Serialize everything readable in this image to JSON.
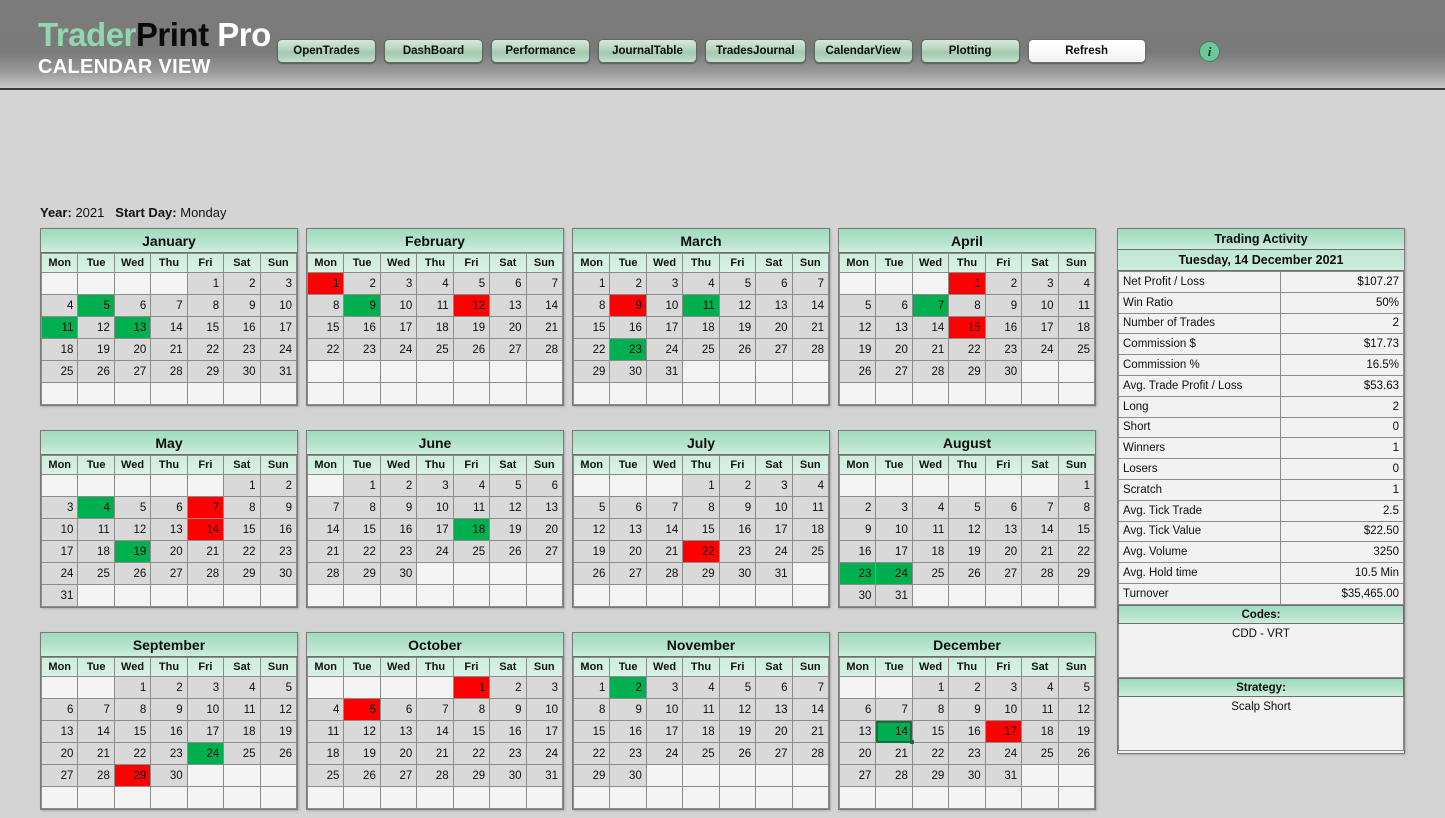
{
  "brand": {
    "part1": "Trader",
    "part2": "Print",
    "part3": " Pro",
    "subtitle": "CALENDAR VIEW"
  },
  "nav": {
    "buttons": [
      {
        "label": "OpenTrades"
      },
      {
        "label": "DashBoard"
      },
      {
        "label": "Performance"
      },
      {
        "label": "JournalTable"
      },
      {
        "label": "TradesJournal"
      },
      {
        "label": "CalendarView"
      },
      {
        "label": "Plotting"
      }
    ],
    "refresh_label": "Refresh",
    "info_label": "i"
  },
  "meta": {
    "year_label": "Year:",
    "year_value": "2021",
    "start_day_label": "Start Day:",
    "start_day_value": "Monday"
  },
  "weekdays": [
    "Mon",
    "Tue",
    "Wed",
    "Thu",
    "Fri",
    "Sat",
    "Sun"
  ],
  "colors": {
    "win": "#00b050",
    "loss": "#ff0000",
    "header_green": "#9fdcbd",
    "brand_green": "#8fd8b0",
    "cell_gray": "#d9d9d9",
    "page_bg": "#d4d4d4",
    "topbar_gray": "#7c7c7c"
  },
  "months": [
    {
      "name": "January",
      "start": 5,
      "days": 31,
      "win": [
        5,
        11,
        13
      ],
      "loss": [],
      "selected": null
    },
    {
      "name": "February",
      "start": 1,
      "days": 28,
      "win": [
        9
      ],
      "loss": [
        1,
        12
      ],
      "selected": null
    },
    {
      "name": "March",
      "start": 1,
      "days": 31,
      "win": [
        11,
        23
      ],
      "loss": [
        9
      ],
      "selected": null
    },
    {
      "name": "April",
      "start": 4,
      "days": 30,
      "win": [
        7
      ],
      "loss": [
        1,
        15
      ],
      "selected": null
    },
    {
      "name": "May",
      "start": 6,
      "days": 31,
      "win": [
        4,
        19
      ],
      "loss": [
        7,
        14
      ],
      "selected": null
    },
    {
      "name": "June",
      "start": 2,
      "days": 30,
      "win": [
        18
      ],
      "loss": [],
      "selected": null
    },
    {
      "name": "July",
      "start": 4,
      "days": 31,
      "win": [],
      "loss": [
        22
      ],
      "selected": null
    },
    {
      "name": "August",
      "start": 7,
      "days": 31,
      "win": [
        23,
        24
      ],
      "loss": [],
      "selected": null
    },
    {
      "name": "September",
      "start": 3,
      "days": 30,
      "win": [
        24
      ],
      "loss": [
        29
      ],
      "selected": null
    },
    {
      "name": "October",
      "start": 5,
      "days": 31,
      "win": [],
      "loss": [
        1,
        5
      ],
      "selected": null
    },
    {
      "name": "November",
      "start": 1,
      "days": 30,
      "win": [
        2
      ],
      "loss": [],
      "selected": null
    },
    {
      "name": "December",
      "start": 3,
      "days": 31,
      "win": [
        14
      ],
      "loss": [
        17
      ],
      "selected": 14
    }
  ],
  "panel": {
    "title": "Trading Activity",
    "date": "Tuesday, 14 December 2021",
    "rows": [
      {
        "key": "Net Profit / Loss",
        "value": "$107.27"
      },
      {
        "key": "Win Ratio",
        "value": "50%"
      },
      {
        "key": "Number of Trades",
        "value": "2"
      },
      {
        "key": "Commission $",
        "value": "$17.73"
      },
      {
        "key": "Commission %",
        "value": "16.5%"
      },
      {
        "key": "Avg. Trade Profit / Loss",
        "value": "$53.63"
      },
      {
        "key": "Long",
        "value": "2"
      },
      {
        "key": "Short",
        "value": "0"
      },
      {
        "key": "Winners",
        "value": "1"
      },
      {
        "key": "Losers",
        "value": "0"
      },
      {
        "key": "Scratch",
        "value": "1"
      },
      {
        "key": "Avg. Tick Trade",
        "value": "2.5"
      },
      {
        "key": "Avg. Tick Value",
        "value": "$22.50"
      },
      {
        "key": "Avg. Volume",
        "value": "3250"
      },
      {
        "key": "Avg. Hold time",
        "value": "10.5 Min"
      },
      {
        "key": "Turnover",
        "value": "$35,465.00"
      }
    ],
    "codes_header": "Codes:",
    "codes_value": "CDD - VRT",
    "strategy_header": "Strategy:",
    "strategy_value": "Scalp Short"
  }
}
